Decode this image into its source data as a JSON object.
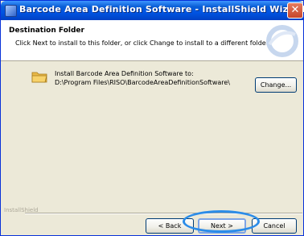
{
  "window": {
    "title": "Barcode Area Definition Software - InstallShield Wizard",
    "close_glyph": "✕"
  },
  "header": {
    "title": "Destination Folder",
    "subtitle": "Click Next to install to this folder, or click Change to install to a different folder."
  },
  "content": {
    "install_label": "Install Barcode Area Definition Software to:",
    "install_path": "D:\\Program Files\\RISO\\BarcodeAreaDefinitionSoftware\\",
    "change_button": "Change..."
  },
  "footer": {
    "brand": "InstallShield",
    "back_button": "< Back",
    "next_button": "Next >",
    "cancel_button": "Cancel"
  },
  "colors": {
    "titlebar": "#0054e3",
    "highlight_ring": "#2b8ce8",
    "folder": "#f7d26a"
  },
  "icons": {
    "title": "installer-app-icon",
    "header": "installshield-swirl-graphic",
    "folder": "folder-icon"
  }
}
